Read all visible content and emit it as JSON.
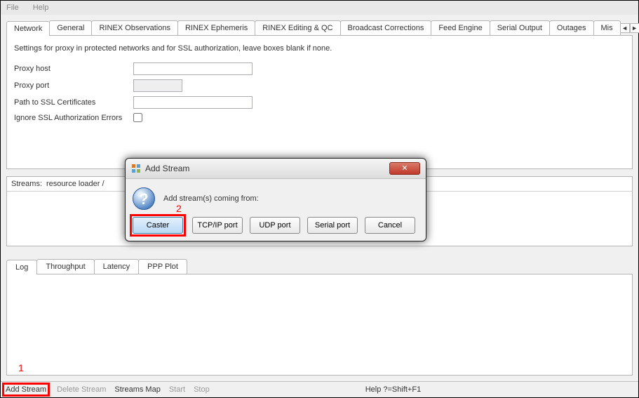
{
  "menu": {
    "file": "File",
    "help": "Help"
  },
  "tabs_top": [
    "Network",
    "General",
    "RINEX Observations",
    "RINEX Ephemeris",
    "RINEX Editing & QC",
    "Broadcast Corrections",
    "Feed Engine",
    "Serial Output",
    "Outages",
    "Mis"
  ],
  "network": {
    "desc": "Settings for proxy in protected networks and for SSL authorization, leave boxes blank if none.",
    "proxy_host": "Proxy host",
    "proxy_port": "Proxy port",
    "ssl_path": "Path to SSL Certificates",
    "ignore_ssl": "Ignore SSL Authorization Errors"
  },
  "streams_label": "Streams:",
  "streams_text": "resource loader /",
  "tabs_bottom": [
    "Log",
    "Throughput",
    "Latency",
    "PPP Plot"
  ],
  "bottom": {
    "add_stream": "Add Stream",
    "delete_stream": "Delete Stream",
    "streams_map": "Streams Map",
    "start": "Start",
    "stop": "Stop",
    "help": "Help ?=Shift+F1"
  },
  "dialog": {
    "title": "Add Stream",
    "message": "Add stream(s) coming from:",
    "buttons": {
      "caster": "Caster",
      "tcpip": "TCP/IP port",
      "udp": "UDP port",
      "serial": "Serial port",
      "cancel": "Cancel"
    }
  },
  "annotations": {
    "a1": "1",
    "a2": "2"
  }
}
